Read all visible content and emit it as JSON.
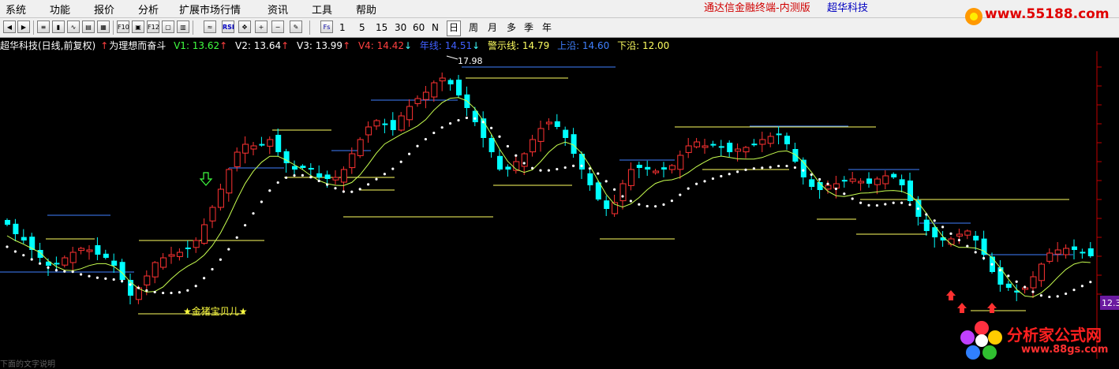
{
  "menu": {
    "items": [
      "系统",
      "功能",
      "报价",
      "分析",
      "扩展市场行情",
      "资讯",
      "工具",
      "帮助"
    ],
    "app_title": "通达信金融终端-内测版",
    "stock_name": "超华科技"
  },
  "logo": {
    "text": "www.55188.com"
  },
  "toolbar": {
    "periods": [
      "1",
      "5",
      "15",
      "30",
      "60",
      "N",
      "日",
      "周",
      "月",
      "多",
      "季",
      "年"
    ],
    "active_period": "日"
  },
  "info": {
    "stock": "超华科技(日线,前复权)",
    "indicator": "为理想而奋斗",
    "v1": "V1: 13.62",
    "v2": "V2: 13.64",
    "v3": "V3: 13.99",
    "v4": "V4: 14.42",
    "annual": "年线: 14.51",
    "warning": "警示线: 14.79",
    "upper": "上沿: 14.60",
    "lower": "下沿: 12.00"
  },
  "chart_data": {
    "type": "candlestick",
    "max_label": "17.98",
    "star_label": "★金猪宝贝儿★",
    "price_label": "12.3",
    "colors": {
      "up": "#ff3232",
      "down": "#00ffff",
      "ma": "#c8ff50",
      "dots": "#ffffff",
      "upper": "#4080ff",
      "lower": "#ffff60"
    }
  },
  "watermark": {
    "title": "分析家公式网",
    "url": "www.88gs.com"
  },
  "footer": {
    "text": "下面的文字说明"
  }
}
